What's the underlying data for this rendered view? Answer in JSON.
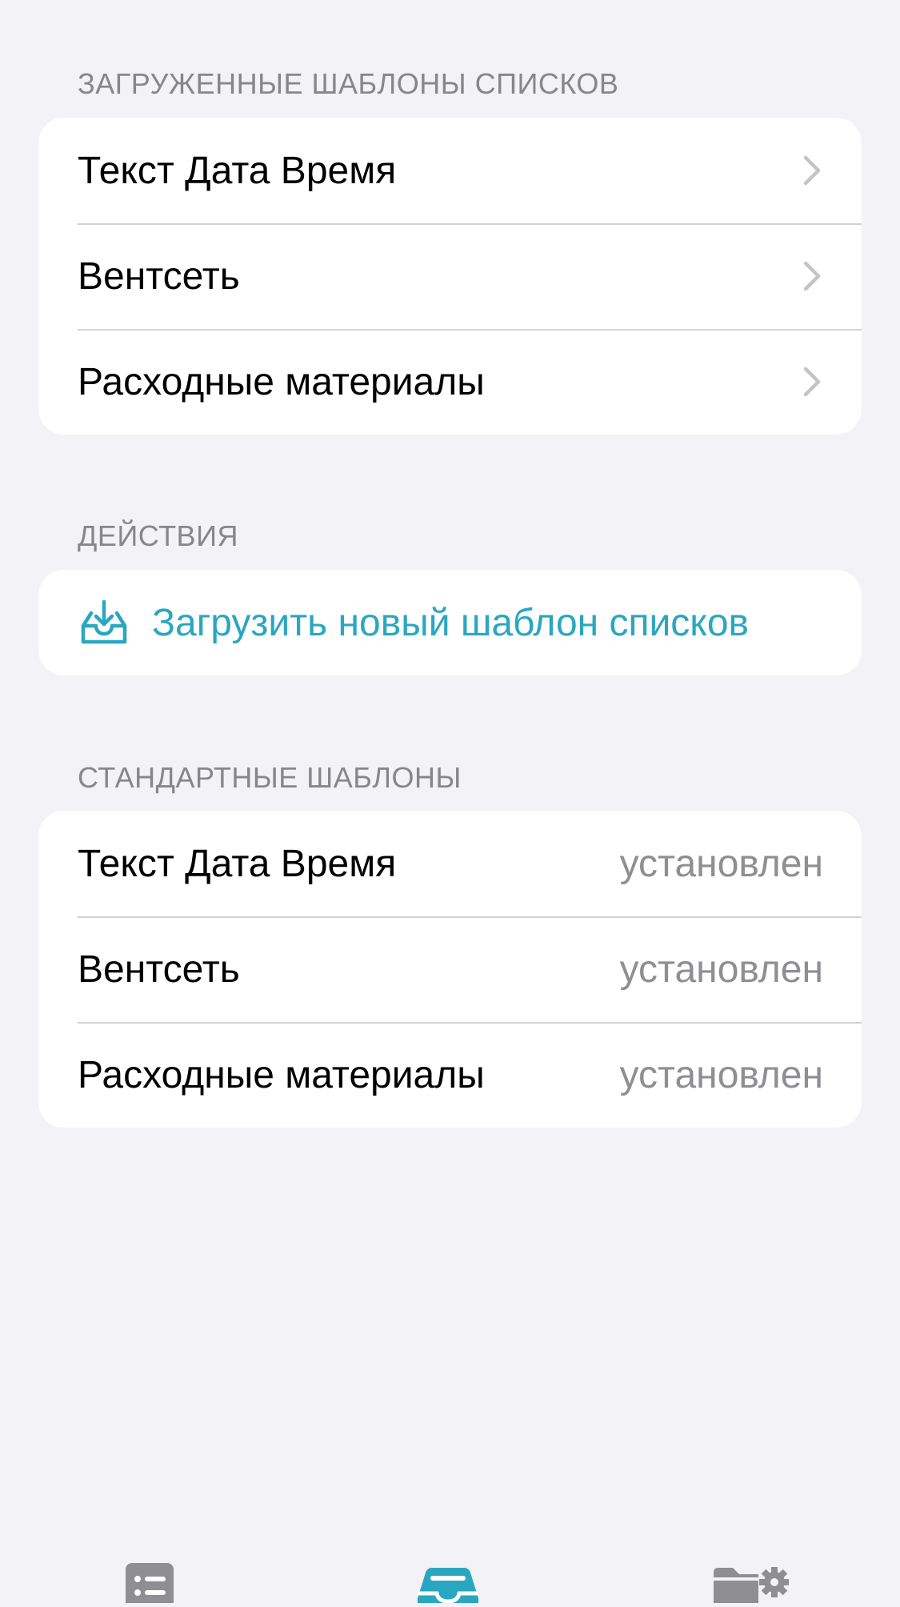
{
  "sections": {
    "loaded": {
      "header": "ЗАГРУЖЕННЫЕ ШАБЛОНЫ СПИСКОВ",
      "items": [
        {
          "label": "Текст Дата Время"
        },
        {
          "label": "Вентсеть"
        },
        {
          "label": "Расходные материалы"
        }
      ]
    },
    "actions": {
      "header": "ДЕЙСТВИЯ",
      "upload_label": "Загрузить новый шаблон списков",
      "upload_icon": "tray-download-icon"
    },
    "standard": {
      "header": "СТАНДАРТНЫЕ ШАБЛОНЫ",
      "items": [
        {
          "label": "Текст Дата Время",
          "status": "установлен"
        },
        {
          "label": "Вентсеть",
          "status": "установлен"
        },
        {
          "label": "Расходные материалы",
          "status": "установлен"
        }
      ]
    }
  },
  "tabbar": {
    "tabs": [
      {
        "icon": "list-icon",
        "active": false
      },
      {
        "icon": "tray-icon",
        "active": true
      },
      {
        "icon": "folder-settings-icon",
        "active": false
      }
    ]
  },
  "colors": {
    "accent": "#2aa7c0",
    "background": "#f2f2f7",
    "secondary_text": "#8e8e93"
  }
}
